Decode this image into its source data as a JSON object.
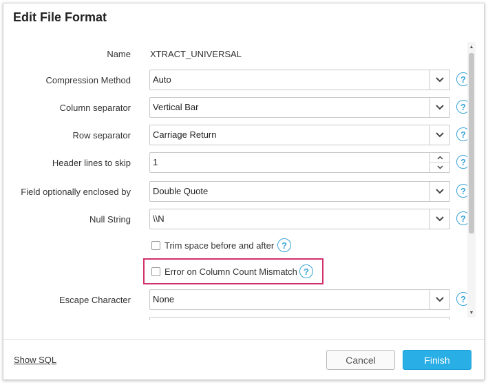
{
  "dialog": {
    "title": "Edit File Format"
  },
  "fields": {
    "name": {
      "label": "Name",
      "value": "XTRACT_UNIVERSAL"
    },
    "compression": {
      "label": "Compression Method",
      "value": "Auto"
    },
    "column_separator": {
      "label": "Column separator",
      "value": "Vertical Bar"
    },
    "row_separator": {
      "label": "Row separator",
      "value": "Carriage Return"
    },
    "header_lines": {
      "label": "Header lines to skip",
      "value": "1"
    },
    "enclosed_by": {
      "label": "Field optionally enclosed by",
      "value": "Double Quote"
    },
    "null_string": {
      "label": "Null String",
      "value": "\\\\N"
    },
    "trim_space": {
      "label": "Trim space before and after",
      "checked": false
    },
    "error_mismatch": {
      "label": "Error on Column Count Mismatch",
      "checked": false
    },
    "escape_char": {
      "label": "Escape Character",
      "value": "None"
    }
  },
  "help_glyph": "?",
  "footer": {
    "show_sql": "Show SQL",
    "cancel": "Cancel",
    "finish": "Finish"
  },
  "colors": {
    "accent": "#29aee6",
    "help": "#3aa4d8",
    "highlight": "#d0306b"
  }
}
